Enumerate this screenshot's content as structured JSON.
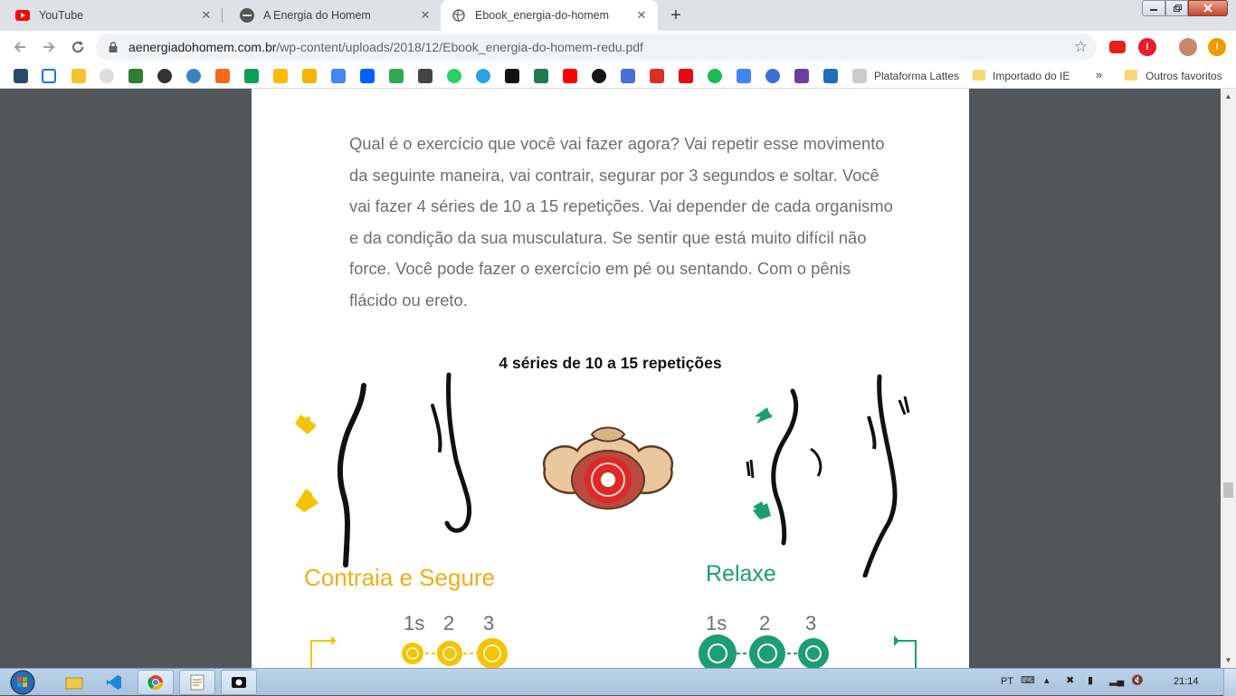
{
  "browser": {
    "tabs": [
      {
        "title": "YouTube",
        "favicon": "youtube-icon",
        "active": false
      },
      {
        "title": "A Energia do Homem",
        "favicon": "site-icon",
        "active": false
      },
      {
        "title": "Ebook_energia-do-homem",
        "favicon": "globe-icon",
        "active": true
      }
    ],
    "close_glyph": "✕",
    "new_tab_glyph": "+",
    "url_host": "aenergiadohomem.com.br",
    "url_path": "/wp-content/uploads/2018/12/Ebook_energia-do-homem-redu.pdf"
  },
  "bookmarks": {
    "items": [
      "Plataforma Lattes",
      "Importado do IE"
    ],
    "overflow": "»",
    "other": "Outros favoritos"
  },
  "document": {
    "paragraph": "Qual é o exercício que você vai fazer agora? Vai repetir esse movimento da seguinte maneira, vai contrair, segurar por 3 segundos e soltar. Você vai fazer 4 séries de 10 a 15 repetições. Vai depender de cada organismo e da condição da sua musculatura. Se sentir que está muito difícil não force. Você pode fazer o exercício em pé ou sentando. Com o pênis flácido ou ereto.",
    "heading": "4 séries de 10 a 15 repetições",
    "contract_label": "Contraia e Segure",
    "relax_label": "Relaxe",
    "contract_counts": [
      "1s",
      "2",
      "3"
    ],
    "relax_counts": [
      "1s",
      "2",
      "3"
    ],
    "colors": {
      "contract": "#f1ad17",
      "contract_dot": "#f5c400",
      "relax": "#1d9d74",
      "target": "#e02424"
    }
  },
  "taskbar": {
    "language": "PT",
    "clock": "21:14"
  }
}
